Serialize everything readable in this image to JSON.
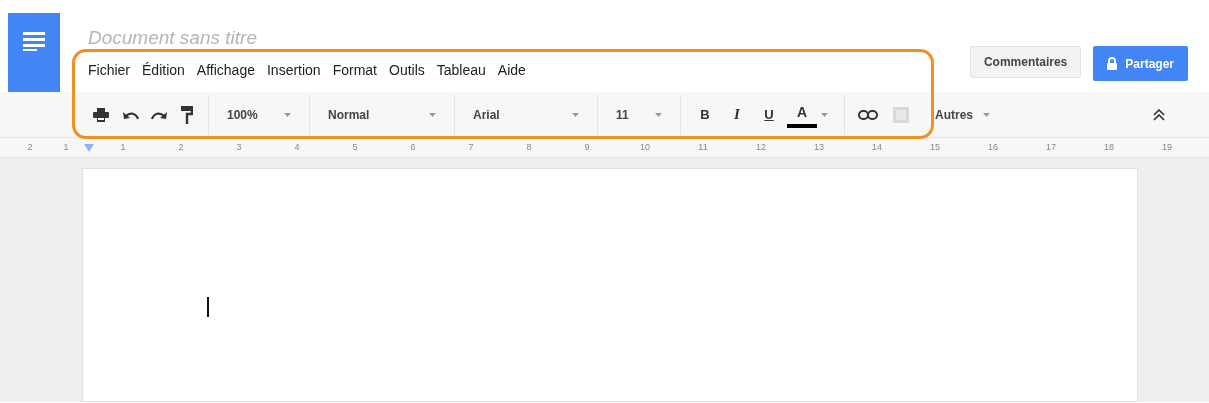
{
  "title": "Document sans titre",
  "menu": [
    "Fichier",
    "Édition",
    "Affichage",
    "Insertion",
    "Format",
    "Outils",
    "Tableau",
    "Aide"
  ],
  "toolbar": {
    "zoom": "100%",
    "style": "Normal",
    "font": "Arial",
    "size": "11",
    "bold": "B",
    "italic": "I",
    "underline": "U",
    "text_color": "A",
    "more": "Autres"
  },
  "buttons": {
    "comments": "Commentaires",
    "share": "Partager"
  },
  "ruler": [
    "2",
    "1",
    "1",
    "2",
    "3",
    "4",
    "5",
    "6",
    "7",
    "8",
    "9",
    "10",
    "11",
    "12",
    "13",
    "14",
    "15",
    "16",
    "17",
    "18",
    "19"
  ]
}
